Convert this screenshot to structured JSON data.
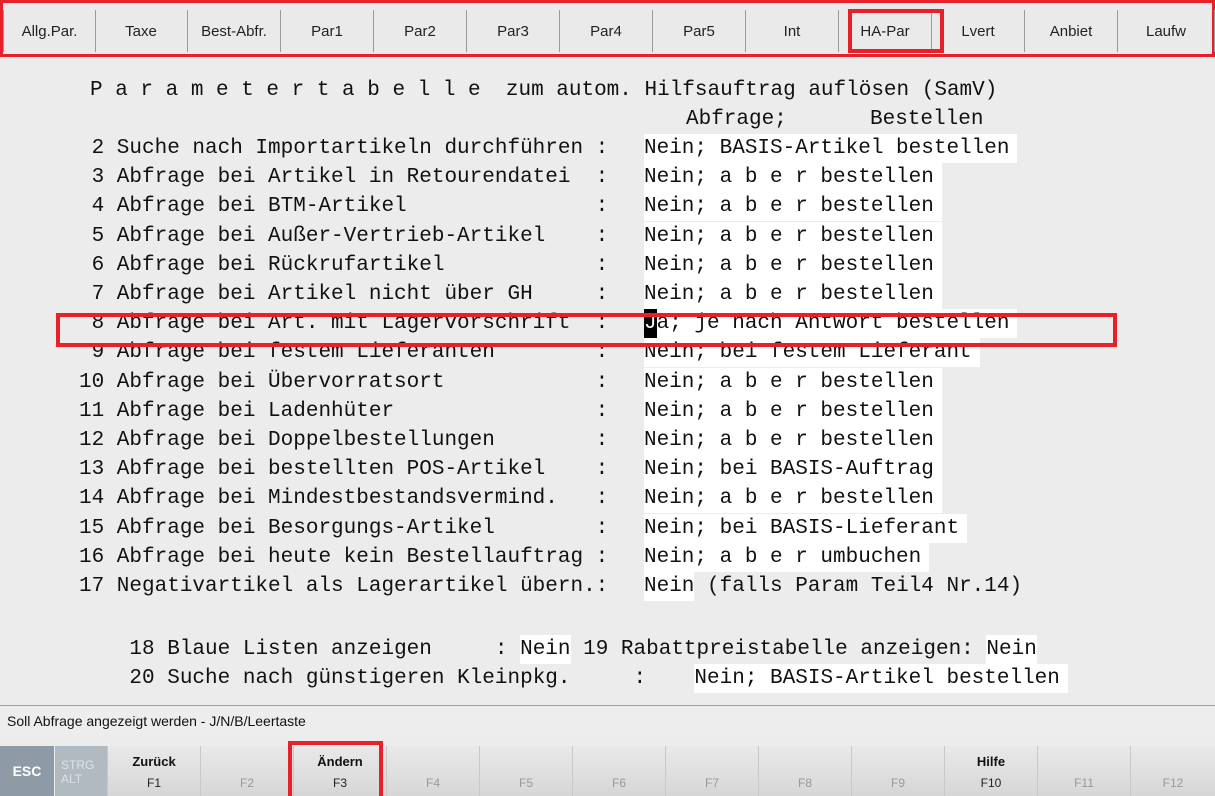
{
  "tabs": [
    "Allg.Par.",
    "Taxe",
    "Best-Abfr.",
    "Par1",
    "Par2",
    "Par3",
    "Par4",
    "Par5",
    "Int",
    "HA-Par",
    "Lvert",
    "Anbiet",
    "Laufw"
  ],
  "selected_tab": "HA-Par",
  "table": {
    "title": "P a r a m e t e r t a b e l l e  zum autom. Hilfsauftrag auflösen (SamV)",
    "col_abfrage": "Abfrage;",
    "col_bestellen": "Bestellen",
    "rows": [
      {
        "label": " 2 Suche nach Importartikeln durchführen :",
        "answer": "Nein; BASIS-Artikel bestellen"
      },
      {
        "label": " 3 Abfrage bei Artikel in Retourendatei  :",
        "answer": "Nein; a b e r bestellen"
      },
      {
        "label": " 4 Abfrage bei BTM-Artikel               :",
        "answer": "Nein; a b e r bestellen"
      },
      {
        "label": " 5 Abfrage bei Außer-Vertrieb-Artikel    :",
        "answer": "Nein; a b e r bestellen"
      },
      {
        "label": " 6 Abfrage bei Rückrufartikel            :",
        "answer": "Nein; a b e r bestellen"
      },
      {
        "label": " 7 Abfrage bei Artikel nicht über GH     :",
        "answer": "Nein; a b e r bestellen"
      },
      {
        "label": " 8 Abfrage bei Art. mit Lagervorschrift  :",
        "answer_cursor": "J",
        "answer": "a; je nach Antwort bestellen"
      },
      {
        "label": " 9 Abfrage bei festem Lieferanten        :",
        "answer": "Nein; bei festem Lieferant"
      },
      {
        "label": "10 Abfrage bei Übervorratsort            :",
        "answer": "Nein; a b e r bestellen"
      },
      {
        "label": "11 Abfrage bei Ladenhüter                :",
        "answer": "Nein; a b e r bestellen"
      },
      {
        "label": "12 Abfrage bei Doppelbestellungen        :",
        "answer": "Nein; a b e r bestellen"
      },
      {
        "label": "13 Abfrage bei bestellten POS-Artikel    :",
        "answer": "Nein; bei BASIS-Auftrag"
      },
      {
        "label": "14 Abfrage bei Mindestbestandsvermind.   :",
        "answer": "Nein; a b e r bestellen"
      },
      {
        "label": "15 Abfrage bei Besorgungs-Artikel        :",
        "answer": "Nein; bei BASIS-Lieferant"
      },
      {
        "label": "16 Abfrage bei heute kein Bestellauftrag :",
        "answer": "Nein; a b e r umbuchen"
      },
      {
        "label": "17 Negativartikel als Lagerartikel übern.:",
        "answer": "Nein",
        "note": " (falls Param Teil4 Nr.14)"
      }
    ],
    "row18": {
      "label": "18 Blaue Listen anzeigen     : ",
      "answer": "Nein",
      "label2": " 19 Rabattpreistabelle anzeigen: ",
      "answer2": "Nein"
    },
    "row20": {
      "label": "20 Suche nach günstigeren Kleinpkg.     :",
      "answer": "Nein; BASIS-Artikel bestellen"
    }
  },
  "status_text": "Soll Abfrage angezeigt werden - J/N/B/Leertaste",
  "fkeys": {
    "esc": "ESC",
    "strg": "STRG",
    "alt": "ALT",
    "keys": [
      {
        "label": "Zurück",
        "key": "F1"
      },
      {
        "label": "",
        "key": "F2"
      },
      {
        "label": "Ändern",
        "key": "F3"
      },
      {
        "label": "",
        "key": "F4"
      },
      {
        "label": "",
        "key": "F5"
      },
      {
        "label": "",
        "key": "F6"
      },
      {
        "label": "",
        "key": "F7"
      },
      {
        "label": "",
        "key": "F8"
      },
      {
        "label": "",
        "key": "F9"
      },
      {
        "label": "Hilfe",
        "key": "F10"
      },
      {
        "label": "",
        "key": "F11"
      },
      {
        "label": "",
        "key": "F12"
      }
    ]
  },
  "colors": {
    "highlight": "#e8202a",
    "answer_bg": "#ffffff",
    "background": "#ececec"
  }
}
